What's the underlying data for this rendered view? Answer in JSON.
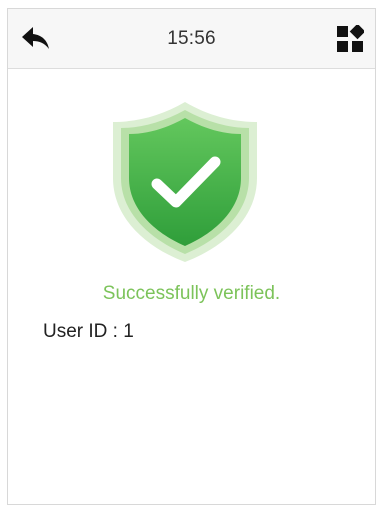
{
  "header": {
    "time": "15:56",
    "back_icon": "back-arrow-icon",
    "menu_icon": "grid-menu-icon"
  },
  "verification": {
    "icon": "shield-checkmark-icon",
    "message": "Successfully verified.",
    "user_id_label": "User ID :",
    "user_id_value": "1"
  },
  "colors": {
    "shield_green": "#4cb84a",
    "shield_halo": "#cfe8c2",
    "message_green": "#7cc35a",
    "header_background": "#f7f7f7",
    "icon_dark": "#111111"
  }
}
